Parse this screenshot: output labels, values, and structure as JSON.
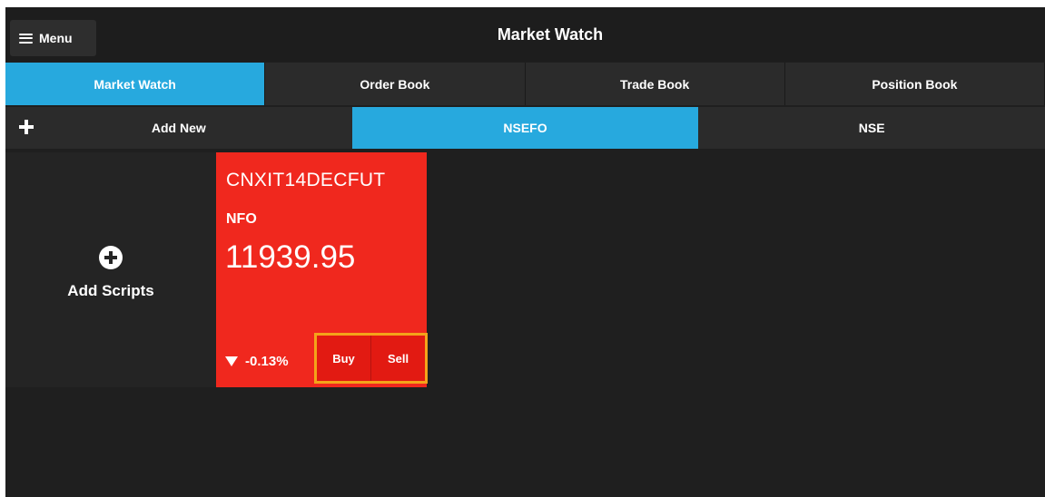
{
  "header": {
    "menu_label": "Menu",
    "title": "Market Watch"
  },
  "main_tabs": [
    {
      "label": "Market Watch",
      "active": true
    },
    {
      "label": "Order Book",
      "active": false
    },
    {
      "label": "Trade Book",
      "active": false
    },
    {
      "label": "Position Book",
      "active": false
    }
  ],
  "group_tabs": [
    {
      "label": "Add New",
      "active": false
    },
    {
      "label": "NSEFO",
      "active": true
    },
    {
      "label": "NSE",
      "active": false
    }
  ],
  "add_card": {
    "label": "Add Scripts"
  },
  "script": {
    "symbol": "CNXIT14DECFUT",
    "exchange": "NFO",
    "price": "11939.95",
    "change": "-0.13%",
    "buy_label": "Buy",
    "sell_label": "Sell",
    "card_color": "#f0281e"
  },
  "colors": {
    "accent": "#27a9de",
    "highlight_border": "#f4a31a"
  },
  "icons": {
    "menu": "hamburger-icon",
    "add_new": "plus-icon",
    "add_scripts": "plus-circle-icon",
    "change": "triangle-down-icon"
  }
}
